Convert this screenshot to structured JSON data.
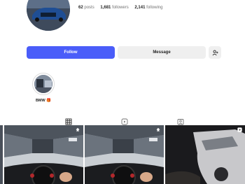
{
  "profile": {
    "stats": [
      {
        "count": "62",
        "label": "posts"
      },
      {
        "count": "1,681",
        "label": "followers"
      },
      {
        "count": "2,141",
        "label": "following"
      }
    ]
  },
  "actions": {
    "follow_label": "Follow",
    "message_label": "Message"
  },
  "highlights": [
    {
      "label": "BMW 🎁"
    }
  ],
  "tabs": [
    {
      "icon": "grid-icon",
      "active": true
    },
    {
      "icon": "reels-icon",
      "active": false
    },
    {
      "icon": "tagged-icon",
      "active": false
    }
  ],
  "colors": {
    "accent": "#4a5df9",
    "secondary_button": "#efefef",
    "text": "#262626"
  }
}
